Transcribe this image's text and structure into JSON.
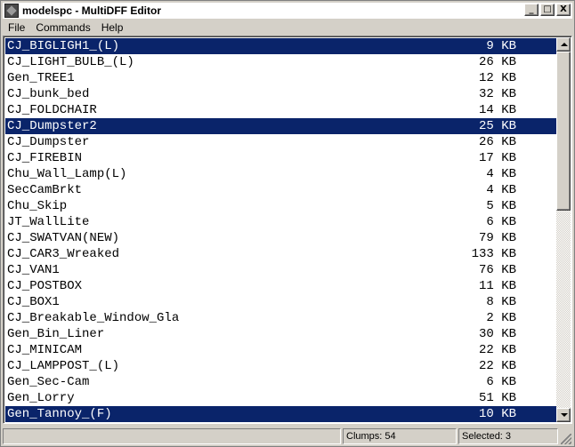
{
  "window": {
    "title": "modelspc - MultiDFF Editor",
    "buttons": {
      "minimize": "_",
      "maximize": "□",
      "close": "X"
    }
  },
  "menu": [
    "File",
    "Commands",
    "Help"
  ],
  "list": {
    "items": [
      {
        "name": "CJ_BIGLIGH1_(L)",
        "size": "9 KB",
        "selected": true
      },
      {
        "name": "CJ_LIGHT_BULB_(L)",
        "size": "26 KB",
        "selected": false
      },
      {
        "name": "Gen_TREE1",
        "size": "12 KB",
        "selected": false
      },
      {
        "name": "CJ_bunk_bed",
        "size": "32 KB",
        "selected": false
      },
      {
        "name": "CJ_FOLDCHAIR",
        "size": "14 KB",
        "selected": false
      },
      {
        "name": "CJ_Dumpster2",
        "size": "25 KB",
        "selected": true
      },
      {
        "name": "CJ_Dumpster",
        "size": "26 KB",
        "selected": false
      },
      {
        "name": "CJ_FIREBIN",
        "size": "17 KB",
        "selected": false
      },
      {
        "name": "Chu_Wall_Lamp(L)",
        "size": "4 KB",
        "selected": false
      },
      {
        "name": "SecCamBrkt",
        "size": "4 KB",
        "selected": false
      },
      {
        "name": "Chu_Skip",
        "size": "5 KB",
        "selected": false
      },
      {
        "name": "JT_WallLite",
        "size": "6 KB",
        "selected": false
      },
      {
        "name": "CJ_SWATVAN(NEW)",
        "size": "79 KB",
        "selected": false
      },
      {
        "name": "CJ_CAR3_Wreaked",
        "size": "133 KB",
        "selected": false
      },
      {
        "name": "CJ_VAN1",
        "size": "76 KB",
        "selected": false
      },
      {
        "name": "CJ_POSTBOX",
        "size": "11 KB",
        "selected": false
      },
      {
        "name": "CJ_BOX1",
        "size": "8 KB",
        "selected": false
      },
      {
        "name": "CJ_Breakable_Window_Gla",
        "size": "2 KB",
        "selected": false
      },
      {
        "name": "Gen_Bin_Liner",
        "size": "30 KB",
        "selected": false
      },
      {
        "name": "CJ_MINICAM",
        "size": "22 KB",
        "selected": false
      },
      {
        "name": "CJ_LAMPPOST_(L)",
        "size": "22 KB",
        "selected": false
      },
      {
        "name": "Gen_Sec-Cam",
        "size": "6 KB",
        "selected": false
      },
      {
        "name": "Gen_Lorry",
        "size": "51 KB",
        "selected": false
      },
      {
        "name": "Gen_Tannoy_(F)",
        "size": "10 KB",
        "selected": true
      }
    ]
  },
  "status": {
    "clumps": "Clumps: 54",
    "selected": "Selected: 3"
  },
  "colors": {
    "selection_bg": "#0a246a",
    "selection_fg": "#ffffff",
    "window_bg": "#d4d0c8"
  }
}
